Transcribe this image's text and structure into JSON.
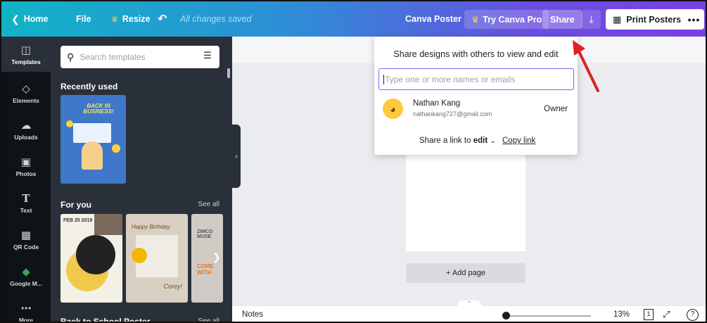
{
  "topbar": {
    "home_label": "Home",
    "file_label": "File",
    "resize_label": "Resize",
    "saved_status": "All changes saved",
    "doc_title": "Canva Poster",
    "try_pro_label": "Try Canva Pro",
    "share_label": "Share",
    "print_label": "Print Posters"
  },
  "rail": {
    "items": [
      {
        "label": "Templates",
        "icon": "templates-icon"
      },
      {
        "label": "Elements",
        "icon": "elements-icon"
      },
      {
        "label": "Uploads",
        "icon": "uploads-icon"
      },
      {
        "label": "Photos",
        "icon": "photos-icon"
      },
      {
        "label": "Text",
        "icon": "text-icon"
      },
      {
        "label": "QR Code",
        "icon": "qr-code-icon"
      },
      {
        "label": "Google M...",
        "icon": "google-maps-icon"
      },
      {
        "label": "More",
        "icon": "more-icon"
      }
    ]
  },
  "panel": {
    "search_placeholder": "Search templates",
    "recently_used": "Recently used",
    "for_you": "For you",
    "see_all": "See all",
    "back_to_school": "Back to School Poster",
    "see_all_2": "See all",
    "recent_poster_text": "BACK IN BUSINESS!",
    "p1_text": "FEB 25 2019",
    "p2_text": "Happy Birthday",
    "p2_text2": "Corey!",
    "p3_text": "ZIMCO MUSE",
    "p3_text2": "COME WITH"
  },
  "share": {
    "title": "Share designs with others to view and edit",
    "placeholder": "Type one or more names or emails",
    "user_name": "Nathan Kang",
    "user_email": "nathankang727@gmail.com",
    "role": "Owner",
    "link_prefix": "Share a link to",
    "link_mode": "edit",
    "copy_link": "Copy link"
  },
  "canvas": {
    "add_page": "+ Add page"
  },
  "bottombar": {
    "notes": "Notes",
    "zoom": "13%",
    "page_number": "1"
  },
  "colors": {
    "topbar_start": "#12b3c6",
    "topbar_end": "#7b3fe3",
    "sidebar": "#0e1318",
    "panel": "#293039",
    "input_focus": "#8b5cf6",
    "annotation_arrow": "#e02020"
  }
}
